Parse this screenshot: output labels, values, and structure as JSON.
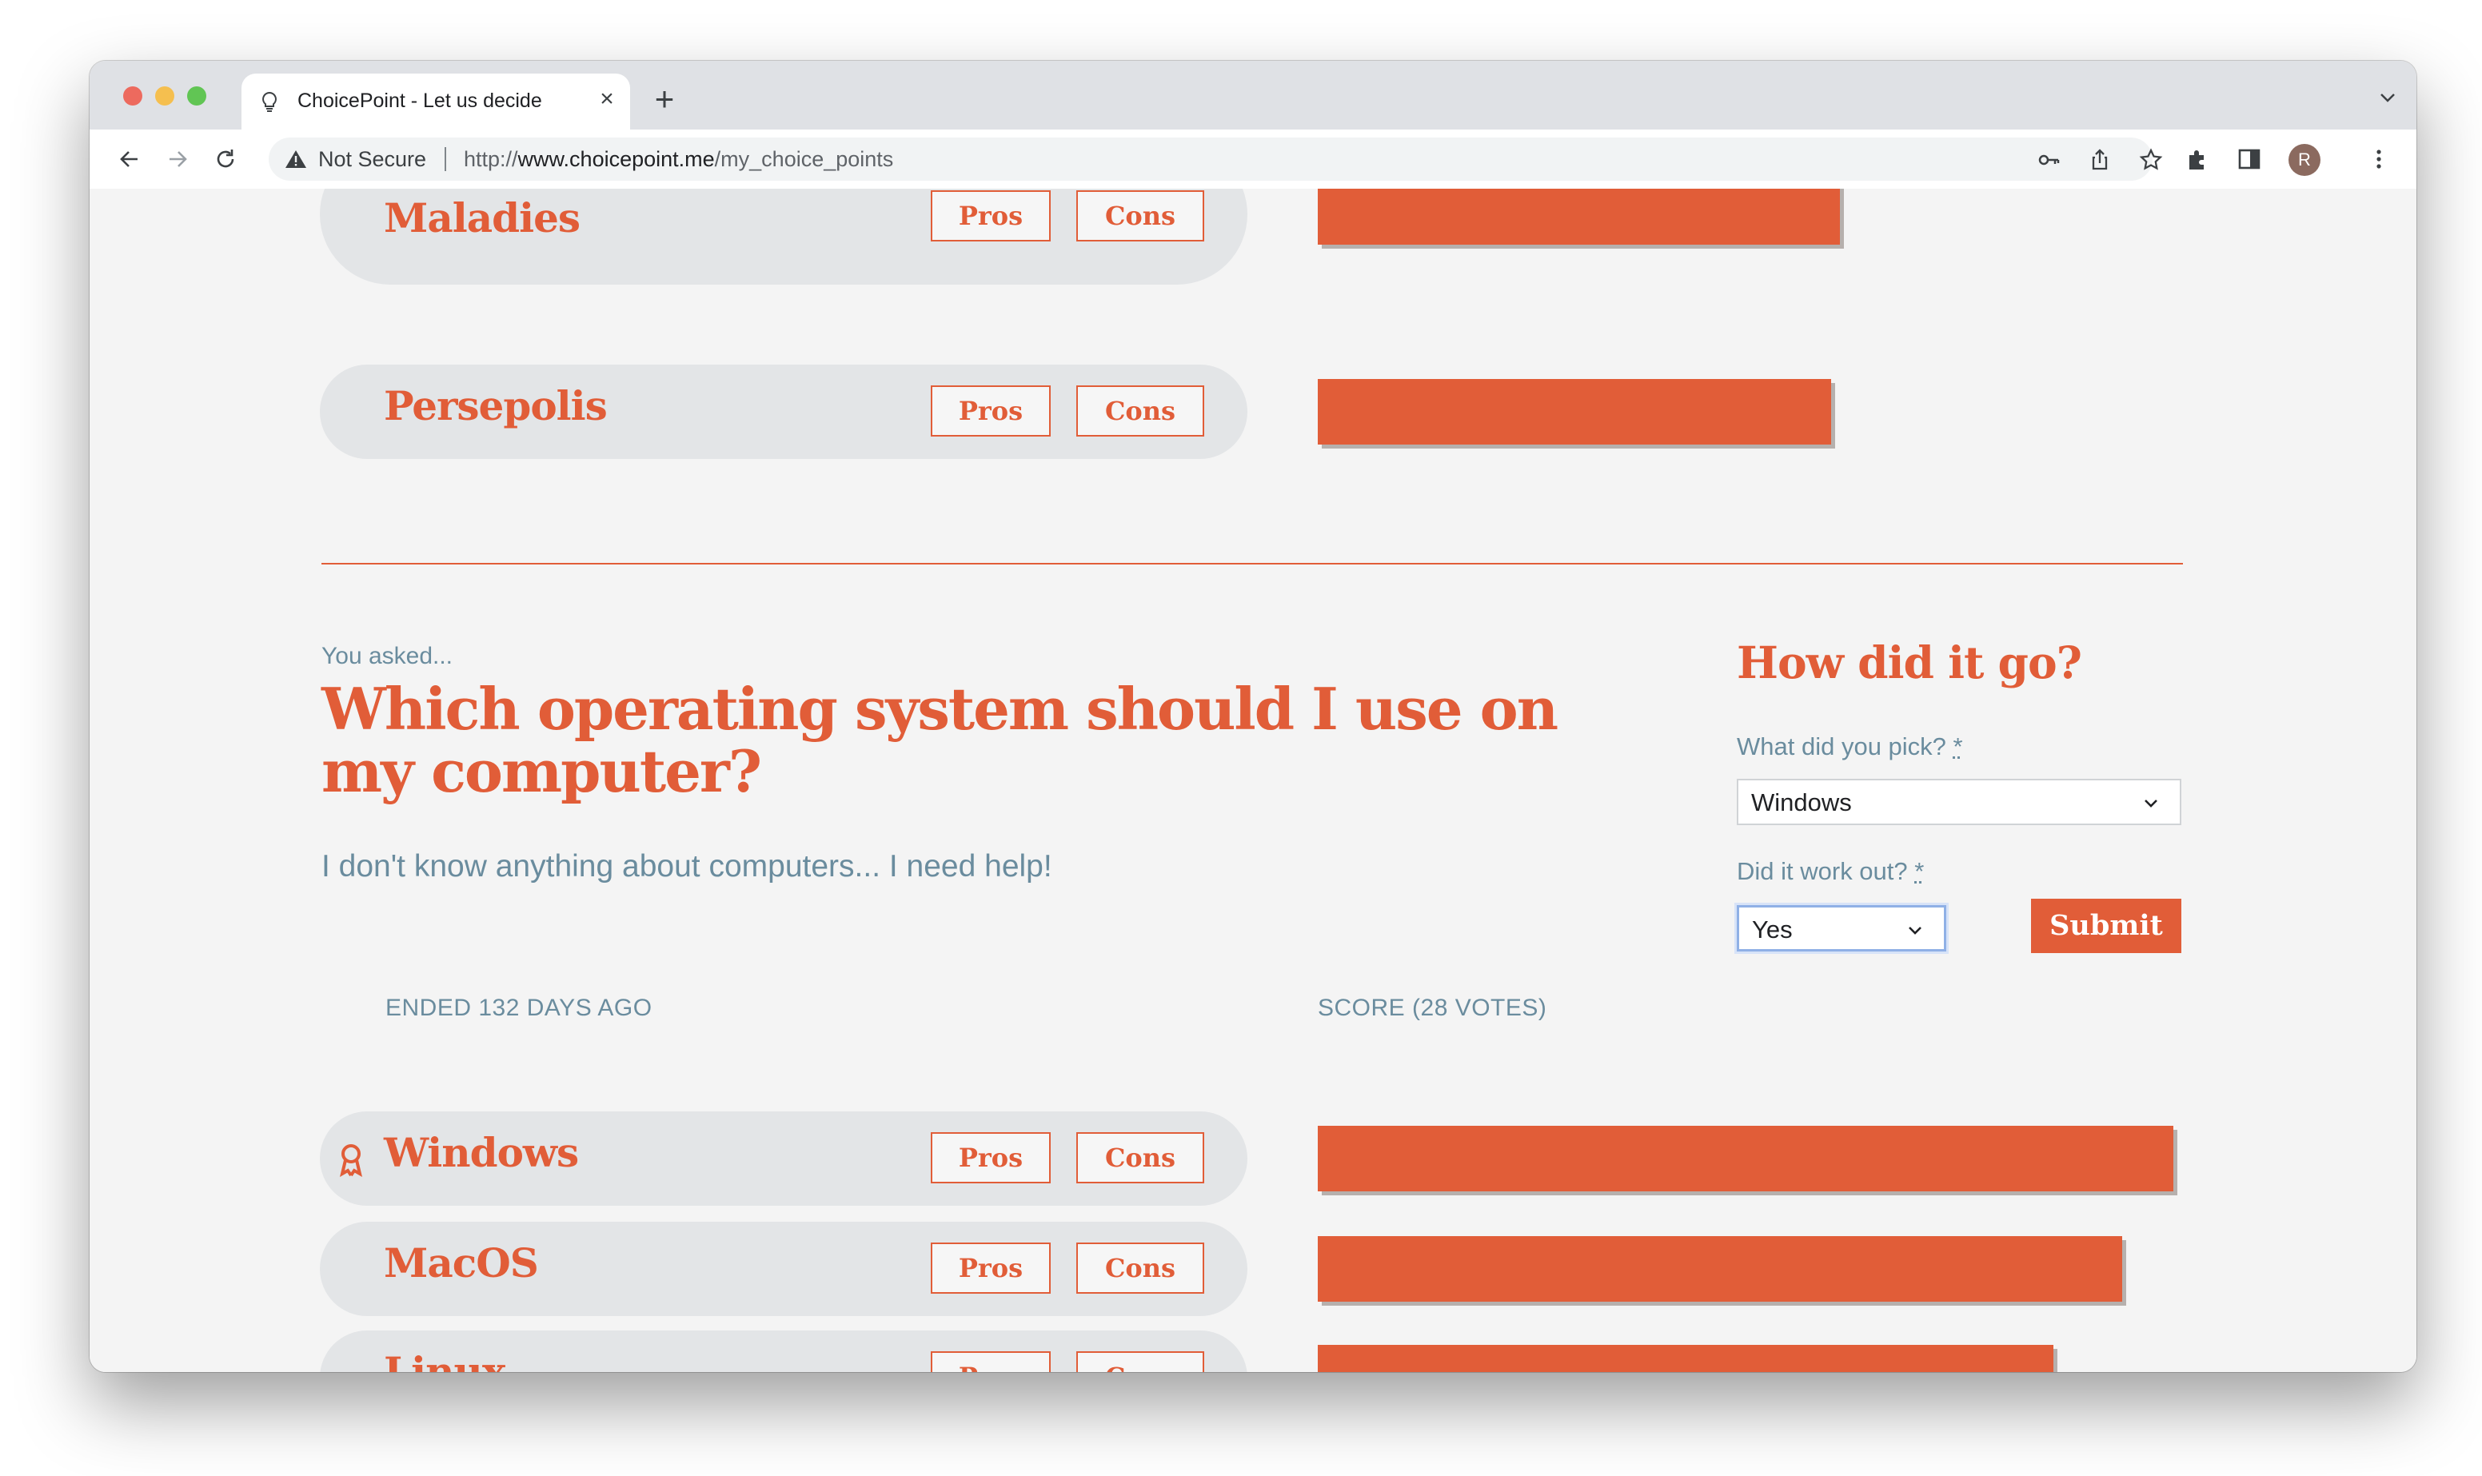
{
  "browser": {
    "tab_title": "ChoicePoint - Let us decide",
    "new_tab": "+",
    "close": "×",
    "security_label": "Not Secure",
    "url_prefix": "http://",
    "url_host": "www.choicepoint.me",
    "url_path": "/my_choice_points",
    "avatar_initial": "R"
  },
  "previous_choice": {
    "options": [
      {
        "name": "The Emperor of All Maladies",
        "pros": "Pros",
        "cons": "Cons",
        "score_fraction": 0.61
      },
      {
        "name": "Persepolis",
        "pros": "Pros",
        "cons": "Cons",
        "score_fraction": 0.6
      }
    ]
  },
  "choice_point": {
    "you_asked": "You asked...",
    "question": "Which operating system should I use on my computer?",
    "description": "I don't know anything about computers... I need help!",
    "status": "ENDED 132 DAYS AGO",
    "score_header": "SCORE (28 VOTES)",
    "options": [
      {
        "name": "Windows",
        "winner": true,
        "pros": "Pros",
        "cons": "Cons",
        "score_fraction": 1.0
      },
      {
        "name": "MacOS",
        "winner": false,
        "pros": "Pros",
        "cons": "Cons",
        "score_fraction": 0.94
      },
      {
        "name": "Linux",
        "winner": false,
        "pros": "Pros",
        "cons": "Cons",
        "score_fraction": 0.86
      }
    ]
  },
  "feedback": {
    "heading": "How did it go?",
    "pick_label": "What did you pick?",
    "pick_value": "Windows",
    "worked_label": "Did it work out?",
    "worked_value": "Yes",
    "required_mark": "*",
    "submit": "Submit"
  },
  "colors": {
    "accent": "#e15d38",
    "muted_text": "#6a8c9e",
    "pill": "#e3e5e7"
  }
}
